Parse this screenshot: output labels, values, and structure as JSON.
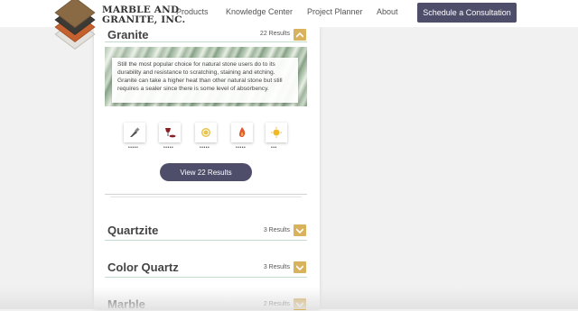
{
  "header": {
    "logo_line1": "MARBLE AND",
    "logo_line2": "GRANITE, INC.",
    "nav": [
      "Products",
      "Knowledge Center",
      "Project Planner",
      "About"
    ],
    "cta_label": "Schedule a Consultation"
  },
  "colors": {
    "accent_button": "#4e4d6a",
    "chevron": "#d8b25d",
    "section_line": "#c4dccd"
  },
  "sections": [
    {
      "title": "Granite",
      "results": "22 Results",
      "chevron": "chevron-up-icon",
      "expanded": true,
      "description": "Still the most popular choice for natural stone users do to its durability and resistance to scratching, staining and etching. Granite can take a higher heat than other natural stone but still requires a sealer since there is some level of absorbency.",
      "attributes": [
        {
          "icon": "knife-icon",
          "dots": "•••••"
        },
        {
          "icon": "wine-spill-icon",
          "dots": "•••••"
        },
        {
          "icon": "lemon-icon",
          "dots": "•••••"
        },
        {
          "icon": "flame-icon",
          "dots": "•••••"
        },
        {
          "icon": "sun-icon",
          "dots": "•••"
        }
      ],
      "view_button": "View 22 Results"
    },
    {
      "title": "Quartzite",
      "results": "3 Results",
      "chevron": "chevron-down-icon"
    },
    {
      "title": "Color Quartz",
      "results": "3 Results",
      "chevron": "chevron-down-icon"
    },
    {
      "title": "Marble",
      "results": "2 Results",
      "chevron": "chevron-down-icon"
    }
  ]
}
